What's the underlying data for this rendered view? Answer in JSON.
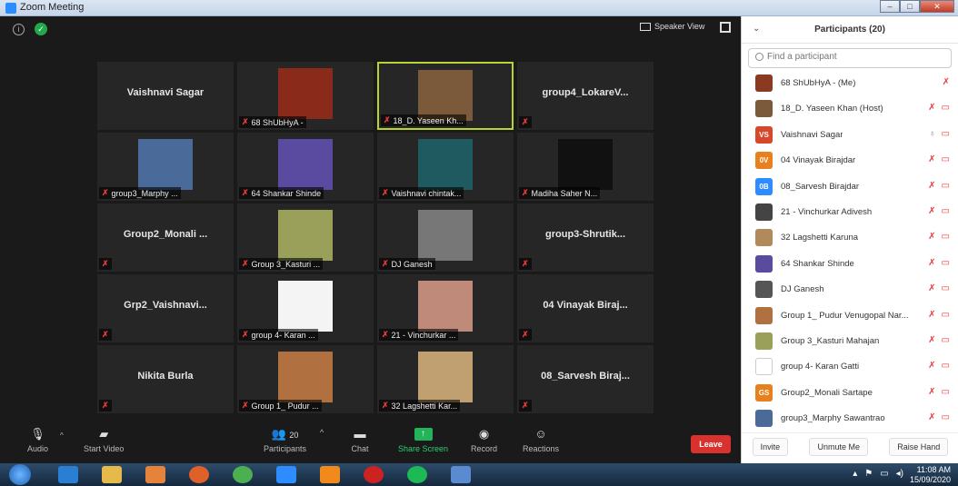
{
  "window": {
    "title": "Zoom Meeting"
  },
  "meeting": {
    "speaker_view_label": "Speaker View",
    "tiles": [
      {
        "name": "Vaishnavi Sagar",
        "label": "",
        "type": "name",
        "muted": false
      },
      {
        "name": "",
        "label": "68 ShUbHyA -",
        "type": "photo",
        "color": "#8a2a1a",
        "muted": true
      },
      {
        "name": "",
        "label": "18_D. Yaseen Kh...",
        "type": "photo",
        "color": "#7a5a3a",
        "muted": true,
        "active": true
      },
      {
        "name": "group4_LokareV...",
        "label": "",
        "type": "name",
        "muted": true
      },
      {
        "name": "",
        "label": "group3_Marphy ...",
        "type": "photo",
        "color": "#4a6a9a",
        "muted": true
      },
      {
        "name": "",
        "label": "64 Shankar Shinde",
        "type": "photo",
        "color": "#5a4aa0",
        "muted": true
      },
      {
        "name": "",
        "label": "Vaishnavi chintak...",
        "type": "photo",
        "color": "#1f5a60",
        "muted": true
      },
      {
        "name": "",
        "label": "Madiha Saher N...",
        "type": "photo",
        "color": "#111111",
        "muted": true
      },
      {
        "name": "Group2_Monali ...",
        "label": "",
        "type": "name",
        "muted": true
      },
      {
        "name": "",
        "label": "Group 3_Kasturi ...",
        "type": "photo",
        "color": "#9aa05a",
        "muted": true
      },
      {
        "name": "",
        "label": "DJ Ganesh",
        "type": "photo",
        "color": "#777777",
        "muted": true
      },
      {
        "name": "group3-Shrutik...",
        "label": "",
        "type": "name",
        "muted": true
      },
      {
        "name": "Grp2_Vaishnavi...",
        "label": "",
        "type": "name",
        "muted": true
      },
      {
        "name": "",
        "label": "group 4- Karan ...",
        "type": "photo",
        "color": "#f4f4f4",
        "muted": true
      },
      {
        "name": "",
        "label": "21 - Vinchurkar ...",
        "type": "photo",
        "color": "#c08a7a",
        "muted": true
      },
      {
        "name": "04 Vinayak Biraj...",
        "label": "",
        "type": "name",
        "muted": true
      },
      {
        "name": "Nikita Burla",
        "label": "",
        "type": "name",
        "muted": true
      },
      {
        "name": "",
        "label": "Group 1_ Pudur ...",
        "type": "photo",
        "color": "#b07040",
        "muted": true
      },
      {
        "name": "",
        "label": "32 Lagshetti Kar...",
        "type": "photo",
        "color": "#c0a070",
        "muted": true
      },
      {
        "name": "08_Sarvesh Biraj...",
        "label": "",
        "type": "name",
        "muted": true
      }
    ]
  },
  "toolbar": {
    "audio": "Audio",
    "start_video": "Start Video",
    "participants": "Participants",
    "participants_count": "20",
    "chat": "Chat",
    "share_screen": "Share Screen",
    "record": "Record",
    "reactions": "Reactions",
    "leave": "Leave"
  },
  "panel": {
    "title": "Participants (20)",
    "search_placeholder": "Find a participant",
    "participants": [
      {
        "name": "68 ShUbHyA - (Me)",
        "avatar_text": "",
        "avatar_color": "#8a3a20",
        "mic": "off",
        "video": false
      },
      {
        "name": "18_D. Yaseen Khan (Host)",
        "avatar_text": "",
        "avatar_color": "#7a5a3a",
        "mic": "off",
        "video": true
      },
      {
        "name": "Vaishnavi Sagar",
        "avatar_text": "VS",
        "avatar_color": "#d9472b",
        "mic": "on",
        "video": true
      },
      {
        "name": "04 Vinayak Birajdar",
        "avatar_text": "0V",
        "avatar_color": "#e8801e",
        "mic": "off",
        "video": true
      },
      {
        "name": "08_Sarvesh Birajdar",
        "avatar_text": "0B",
        "avatar_color": "#2d8cff",
        "mic": "off",
        "video": true
      },
      {
        "name": "21 - Vinchurkar Adivesh",
        "avatar_text": "",
        "avatar_color": "#444444",
        "mic": "off",
        "video": true
      },
      {
        "name": "32 Lagshetti Karuna",
        "avatar_text": "",
        "avatar_color": "#b08a5a",
        "mic": "off",
        "video": true
      },
      {
        "name": "64 Shankar Shinde",
        "avatar_text": "",
        "avatar_color": "#5a4aa0",
        "mic": "off",
        "video": true
      },
      {
        "name": "DJ Ganesh",
        "avatar_text": "",
        "avatar_color": "#555555",
        "mic": "off",
        "video": true
      },
      {
        "name": "Group 1_ Pudur Venugopal Nar...",
        "avatar_text": "",
        "avatar_color": "#b07040",
        "mic": "off",
        "video": true
      },
      {
        "name": "Group 3_Kasturi Mahajan",
        "avatar_text": "",
        "avatar_color": "#9aa05a",
        "mic": "off",
        "video": true
      },
      {
        "name": "group 4- Karan Gatti",
        "avatar_text": "",
        "avatar_color": "#ffffff",
        "mic": "off",
        "video": true
      },
      {
        "name": "Group2_Monali Sartape",
        "avatar_text": "GS",
        "avatar_color": "#e8801e",
        "mic": "off",
        "video": true
      },
      {
        "name": "group3_Marphy Sawantrao",
        "avatar_text": "",
        "avatar_color": "#4a6a9a",
        "mic": "off",
        "video": true
      }
    ],
    "buttons": {
      "invite": "Invite",
      "unmute_me": "Unmute Me",
      "raise_hand": "Raise Hand"
    }
  },
  "taskbar": {
    "time": "11:08 AM",
    "date": "15/09/2020"
  },
  "colors": {
    "accent": "#2d8cff",
    "leave": "#d9322e",
    "muted": "#e8393b",
    "active_border": "#b8d332"
  }
}
